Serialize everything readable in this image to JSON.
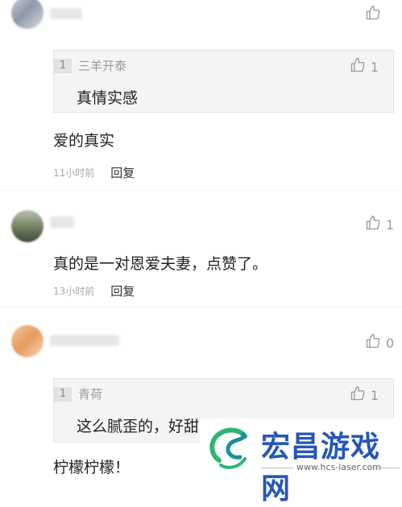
{
  "comments": [
    {
      "like_count": "",
      "quote": {
        "index": "1",
        "author": "三羊开泰",
        "text": "真情实感",
        "like_count": "1"
      },
      "body": "爱的真实",
      "time": "11小时前",
      "reply": "回复"
    },
    {
      "like_count": "1",
      "body": "真的是一对恩爱夫妻，点赞了。",
      "time": "13小时前",
      "reply": "回复"
    },
    {
      "like_count": "0",
      "quote": {
        "index": "1",
        "author": "青荷",
        "text": "这么腻歪的，好甜蜜",
        "like_count": "1"
      },
      "body": "柠檬柠檬！"
    }
  ],
  "watermark": {
    "title": "宏昌游戏网",
    "url": "www.hcs-laser.com",
    "colors": {
      "title": "#2457b8",
      "logo_green": "#2bb673",
      "logo_teal": "#1a8f9e"
    }
  },
  "icons": {
    "like": "thumbs-up-icon"
  }
}
